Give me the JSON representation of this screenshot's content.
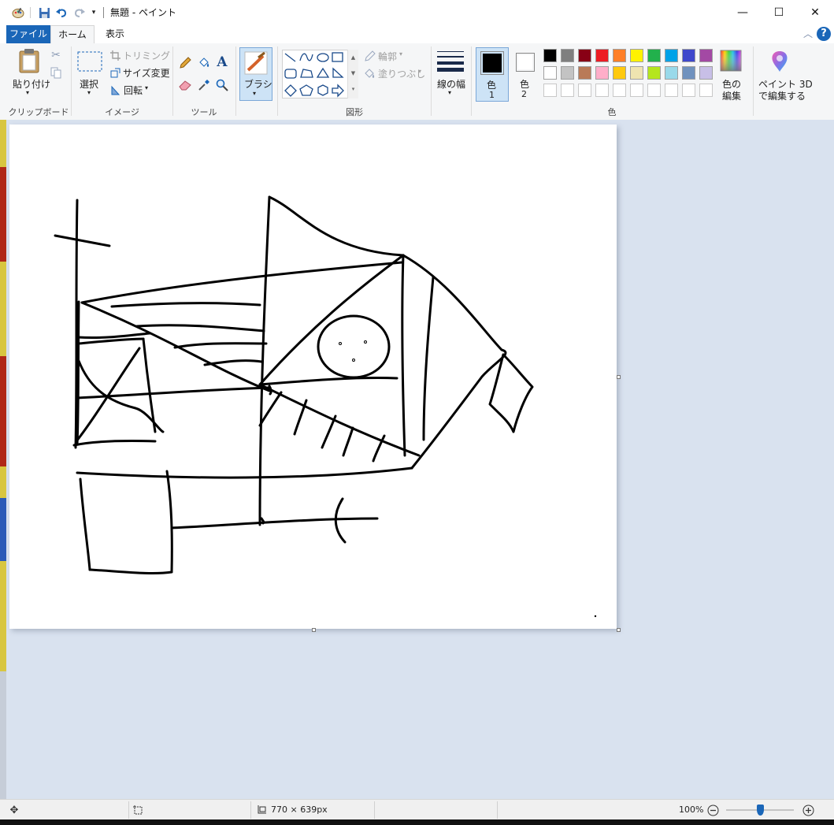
{
  "window": {
    "title": "無題 - ペイント",
    "minimize_glyph": "—",
    "maximize_glyph": "☐",
    "close_glyph": "✕"
  },
  "tabs": {
    "file": "ファイル",
    "home": "ホーム",
    "view": "表示",
    "help": "?"
  },
  "clipboard": {
    "paste": "貼り付け",
    "label": "クリップボード"
  },
  "image": {
    "select": "選択",
    "crop": "トリミング",
    "resize": "サイズ変更",
    "rotate": "回転",
    "label": "イメージ"
  },
  "tools": {
    "label": "ツール",
    "text_glyph": "A"
  },
  "brushes": {
    "label": "ブラシ"
  },
  "shapes": {
    "outline": "輪郭",
    "fill": "塗りつぶし",
    "label": "図形"
  },
  "size": {
    "label": "線の幅"
  },
  "colors": {
    "color1_label": "色",
    "color1_num": "1",
    "color2_label": "色",
    "color2_num": "2",
    "edit_line1": "色の",
    "edit_line2": "編集",
    "paint3d_line1": "ペイント 3D",
    "paint3d_line2": "で編集する",
    "label": "色",
    "color1": "#000000",
    "color2": "#ffffff",
    "palette_row1": [
      "#000000",
      "#7f7f7f",
      "#880015",
      "#ed1c24",
      "#ff7f27",
      "#fff200",
      "#22b14c",
      "#00a2e8",
      "#3f48cc",
      "#a349a4"
    ],
    "palette_row2": [
      "#ffffff",
      "#c3c3c3",
      "#b97a57",
      "#ffaec9",
      "#ffc90e",
      "#efe4b0",
      "#b5e61d",
      "#99d9ea",
      "#7092be",
      "#c8bfe7"
    ],
    "palette_row3": [
      "#ffffff",
      "#ffffff",
      "#ffffff",
      "#ffffff",
      "#ffffff",
      "#ffffff",
      "#ffffff",
      "#ffffff",
      "#ffffff",
      "#ffffff"
    ]
  },
  "statusbar": {
    "canvas_size": "770 × 639px",
    "zoom": "100%",
    "zoom_level_percent": 100
  }
}
